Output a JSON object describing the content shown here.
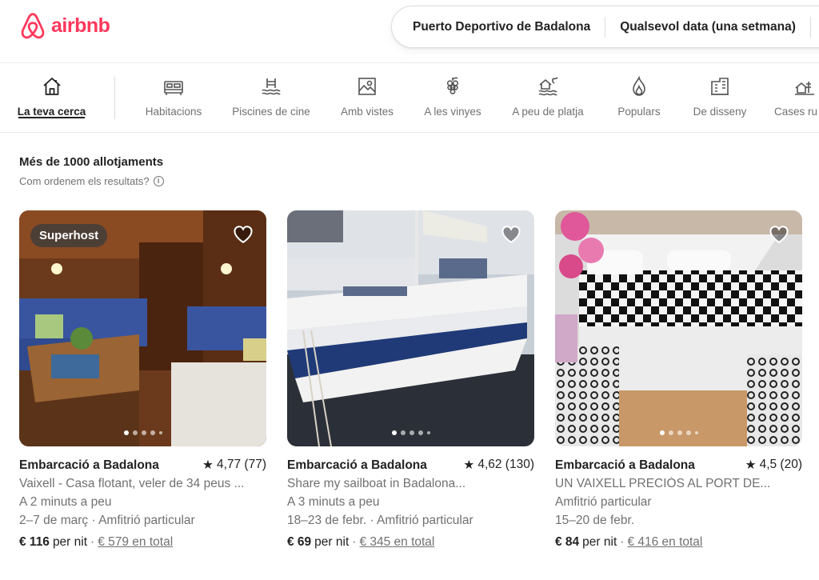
{
  "brand": {
    "name": "airbnb",
    "color": "#ff385c"
  },
  "search": {
    "location": "Puerto Deportivo de Badalona",
    "dates": "Qualsevol data (una setmana)"
  },
  "categories": [
    {
      "label": "La teva cerca",
      "icon": "house-icon",
      "active": true
    },
    {
      "label": "Habitacions",
      "icon": "bed-icon"
    },
    {
      "label": "Piscines de cine",
      "icon": "pool-icon"
    },
    {
      "label": "Amb vistes",
      "icon": "view-icon"
    },
    {
      "label": "A les vinyes",
      "icon": "grapes-icon"
    },
    {
      "label": "A peu de platja",
      "icon": "beach-icon"
    },
    {
      "label": "Populars",
      "icon": "flame-icon"
    },
    {
      "label": "De disseny",
      "icon": "design-building-icon"
    },
    {
      "label": "Cases ru",
      "icon": "countryside-icon"
    }
  ],
  "results": {
    "count_text": "Més de 1000 allotjaments",
    "sort_text": "Com ordenem els resultats?"
  },
  "listings": [
    {
      "badge": "Superhost",
      "title": "Embarcació a Badalona",
      "rating": "4,77 (77)",
      "subtitle": "Vaixell - Casa flotant, veler de 34 peus ...",
      "distance": "A 2 minuts a peu",
      "dates_host": "2–7 de març · Amfitrió particular",
      "price": "€ 116",
      "per_night": "per nit",
      "total": "€ 579 en total"
    },
    {
      "title": "Embarcació a Badalona",
      "rating": "4,62 (130)",
      "subtitle": "Share my sailboat in Badalona...",
      "distance": "A 3 minuts a peu",
      "dates_host": "18–23 de febr. · Amfitrió particular",
      "price": "€ 69",
      "per_night": "per nit",
      "total": "€ 345 en total"
    },
    {
      "title": "Embarcació a Badalona",
      "rating": "4,5 (20)",
      "subtitle": "UN VAIXELL PRECIÓS AL PORT DE...",
      "distance": "Amfitrió particular",
      "dates_host": "15–20 de febr.",
      "price": "€ 84",
      "per_night": "per nit",
      "total": "€ 416 en total"
    }
  ]
}
